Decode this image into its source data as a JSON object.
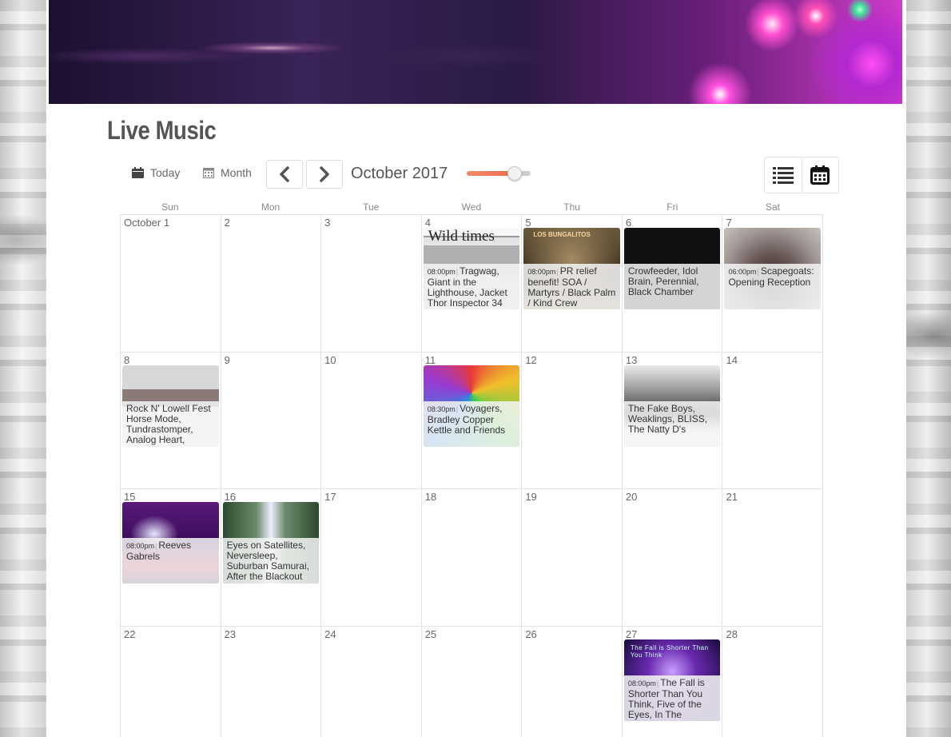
{
  "page": {
    "title": "Live Music"
  },
  "toolbar": {
    "today_label": "Today",
    "month_label": "Month",
    "current_month": "October 2017",
    "zoom_slider_value": 0.75,
    "views": [
      {
        "name": "list-view",
        "icon": "list-icon"
      },
      {
        "name": "calendar-view",
        "icon": "calendar-icon"
      }
    ]
  },
  "calendar": {
    "weekdays": [
      "Sun",
      "Mon",
      "Tue",
      "Wed",
      "Thu",
      "Fri",
      "Sat"
    ],
    "weeks": [
      [
        {
          "day": "October 1"
        },
        {
          "day": "2"
        },
        {
          "day": "3"
        },
        {
          "day": "4",
          "event": {
            "time": "08:00pm",
            "title": "Tragwag, Giant in the Lighthouse, Jacket Thor Inspector 34",
            "image_text": "Wild times",
            "image": "img1"
          }
        },
        {
          "day": "5",
          "event": {
            "time": "08:00pm",
            "title": "PR relief benefit! SOA / Martyrs / Black Palm / Kind Crew",
            "image_text": "LOS BUNGALITOS",
            "image": "img2"
          }
        },
        {
          "day": "6",
          "event": {
            "time": "",
            "title": "Crowfeeder, Idol Brain, Perennial, Black Chamber",
            "image_text": "",
            "image": "img3"
          }
        },
        {
          "day": "7",
          "event": {
            "time": "06:00pm",
            "title": "Scapegoats: Opening Reception",
            "image_text": "",
            "image": "img4"
          }
        }
      ],
      [
        {
          "day": "8",
          "event": {
            "time": "",
            "title": "Rock N' Lowell Fest Horse Mode, Tundrastomper, Analog Heart,",
            "image_text": "",
            "image": "img5"
          }
        },
        {
          "day": "9"
        },
        {
          "day": "10"
        },
        {
          "day": "11",
          "event": {
            "time": "08:30pm",
            "title": "Voyagers, Bradley Copper Kettle and Friends",
            "image_text": "",
            "image": "img6"
          }
        },
        {
          "day": "12"
        },
        {
          "day": "13",
          "event": {
            "time": "",
            "title": "The Fake Boys, Weaklings, BLISS, The Natty D's",
            "image_text": "",
            "image": "img7"
          }
        },
        {
          "day": "14"
        }
      ],
      [
        {
          "day": "15",
          "event": {
            "time": "08:00pm",
            "title": "Reeves Gabrels",
            "image_text": "",
            "image": "img8"
          }
        },
        {
          "day": "16",
          "event": {
            "time": "",
            "title": "Eyes on Satellites, Neversleep, Suburban Samurai, After the Blackout",
            "image_text": "",
            "image": "img9"
          }
        },
        {
          "day": "17"
        },
        {
          "day": "18"
        },
        {
          "day": "19"
        },
        {
          "day": "20"
        },
        {
          "day": "21"
        }
      ],
      [
        {
          "day": "22"
        },
        {
          "day": "23"
        },
        {
          "day": "24"
        },
        {
          "day": "25"
        },
        {
          "day": "26"
        },
        {
          "day": "27",
          "event": {
            "time": "08:00pm",
            "title": "The Fall is Shorter Than You Think, Five of the Eyes, In The",
            "image_text": "The Fall is Shorter Than You Think",
            "image": "img10"
          }
        },
        {
          "day": "28"
        }
      ]
    ]
  },
  "colors": {
    "slider_fill": "#ef6b4b",
    "background": "#ffffff",
    "text": "#444444"
  }
}
